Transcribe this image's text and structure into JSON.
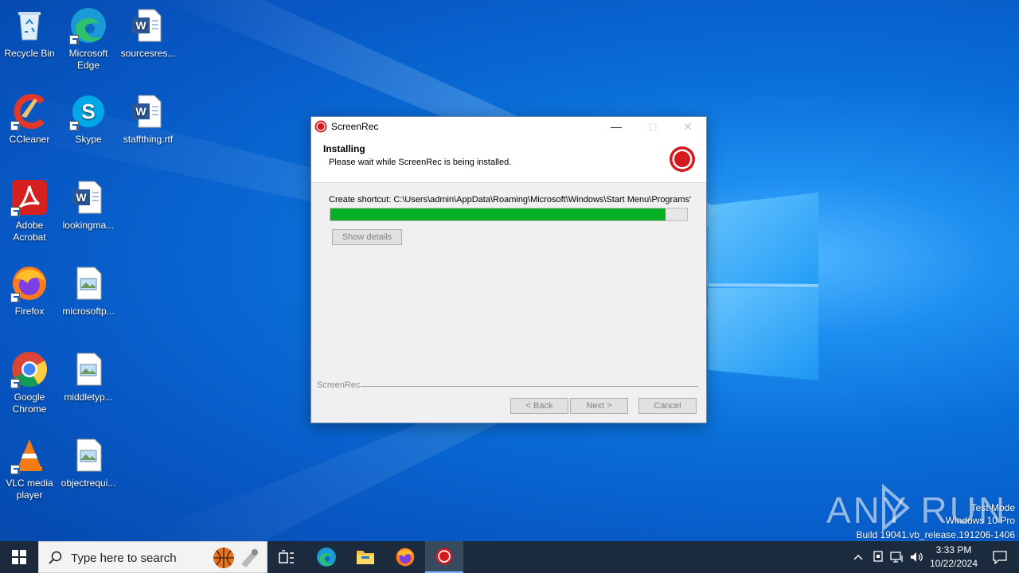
{
  "desktop": {
    "icons": [
      {
        "label": "Recycle Bin"
      },
      {
        "label": "Microsoft Edge"
      },
      {
        "label": "sourcesres..."
      },
      {
        "label": "CCleaner"
      },
      {
        "label": "Skype"
      },
      {
        "label": "staffthing.rtf"
      },
      {
        "label": "Adobe Acrobat"
      },
      {
        "label": "lookingma..."
      },
      {
        "label": "Firefox"
      },
      {
        "label": "microsoftp..."
      },
      {
        "label": "Google Chrome"
      },
      {
        "label": "middletyp..."
      },
      {
        "label": "VLC media player"
      },
      {
        "label": "objectrequi..."
      }
    ]
  },
  "installer": {
    "title": "ScreenRec",
    "header_title": "Installing",
    "header_subtitle": "Please wait while ScreenRec is being installed.",
    "status": "Create shortcut: C:\\Users\\admin\\AppData\\Roaming\\Microsoft\\Windows\\Start Menu\\Programs'",
    "progress_percent": 94,
    "show_details_label": "Show details",
    "brand_label": "ScreenRec",
    "back_label": "< Back",
    "next_label": "Next >",
    "cancel_label": "Cancel",
    "accent": "#06b025",
    "logo_color": "#d6191e"
  },
  "watermark": {
    "brand": "ANY RUN",
    "line1": "Test Mode",
    "line2": "Windows 10 Pro",
    "line3": "Build 19041.vb_release.191206-1406"
  },
  "taskbar": {
    "search_placeholder": "Type here to search",
    "time": "3:33 PM",
    "date": "10/22/2024"
  }
}
